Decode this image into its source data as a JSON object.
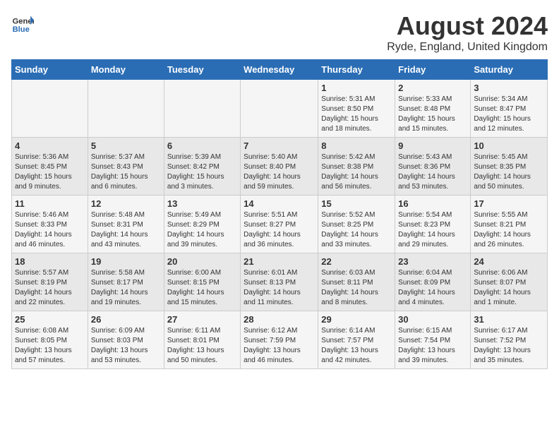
{
  "header": {
    "logo_line1": "General",
    "logo_line2": "Blue",
    "main_title": "August 2024",
    "subtitle": "Ryde, England, United Kingdom"
  },
  "days_of_week": [
    "Sunday",
    "Monday",
    "Tuesday",
    "Wednesday",
    "Thursday",
    "Friday",
    "Saturday"
  ],
  "weeks": [
    [
      {
        "num": "",
        "info": ""
      },
      {
        "num": "",
        "info": ""
      },
      {
        "num": "",
        "info": ""
      },
      {
        "num": "",
        "info": ""
      },
      {
        "num": "1",
        "info": "Sunrise: 5:31 AM\nSunset: 8:50 PM\nDaylight: 15 hours\nand 18 minutes."
      },
      {
        "num": "2",
        "info": "Sunrise: 5:33 AM\nSunset: 8:48 PM\nDaylight: 15 hours\nand 15 minutes."
      },
      {
        "num": "3",
        "info": "Sunrise: 5:34 AM\nSunset: 8:47 PM\nDaylight: 15 hours\nand 12 minutes."
      }
    ],
    [
      {
        "num": "4",
        "info": "Sunrise: 5:36 AM\nSunset: 8:45 PM\nDaylight: 15 hours\nand 9 minutes."
      },
      {
        "num": "5",
        "info": "Sunrise: 5:37 AM\nSunset: 8:43 PM\nDaylight: 15 hours\nand 6 minutes."
      },
      {
        "num": "6",
        "info": "Sunrise: 5:39 AM\nSunset: 8:42 PM\nDaylight: 15 hours\nand 3 minutes."
      },
      {
        "num": "7",
        "info": "Sunrise: 5:40 AM\nSunset: 8:40 PM\nDaylight: 14 hours\nand 59 minutes."
      },
      {
        "num": "8",
        "info": "Sunrise: 5:42 AM\nSunset: 8:38 PM\nDaylight: 14 hours\nand 56 minutes."
      },
      {
        "num": "9",
        "info": "Sunrise: 5:43 AM\nSunset: 8:36 PM\nDaylight: 14 hours\nand 53 minutes."
      },
      {
        "num": "10",
        "info": "Sunrise: 5:45 AM\nSunset: 8:35 PM\nDaylight: 14 hours\nand 50 minutes."
      }
    ],
    [
      {
        "num": "11",
        "info": "Sunrise: 5:46 AM\nSunset: 8:33 PM\nDaylight: 14 hours\nand 46 minutes."
      },
      {
        "num": "12",
        "info": "Sunrise: 5:48 AM\nSunset: 8:31 PM\nDaylight: 14 hours\nand 43 minutes."
      },
      {
        "num": "13",
        "info": "Sunrise: 5:49 AM\nSunset: 8:29 PM\nDaylight: 14 hours\nand 39 minutes."
      },
      {
        "num": "14",
        "info": "Sunrise: 5:51 AM\nSunset: 8:27 PM\nDaylight: 14 hours\nand 36 minutes."
      },
      {
        "num": "15",
        "info": "Sunrise: 5:52 AM\nSunset: 8:25 PM\nDaylight: 14 hours\nand 33 minutes."
      },
      {
        "num": "16",
        "info": "Sunrise: 5:54 AM\nSunset: 8:23 PM\nDaylight: 14 hours\nand 29 minutes."
      },
      {
        "num": "17",
        "info": "Sunrise: 5:55 AM\nSunset: 8:21 PM\nDaylight: 14 hours\nand 26 minutes."
      }
    ],
    [
      {
        "num": "18",
        "info": "Sunrise: 5:57 AM\nSunset: 8:19 PM\nDaylight: 14 hours\nand 22 minutes."
      },
      {
        "num": "19",
        "info": "Sunrise: 5:58 AM\nSunset: 8:17 PM\nDaylight: 14 hours\nand 19 minutes."
      },
      {
        "num": "20",
        "info": "Sunrise: 6:00 AM\nSunset: 8:15 PM\nDaylight: 14 hours\nand 15 minutes."
      },
      {
        "num": "21",
        "info": "Sunrise: 6:01 AM\nSunset: 8:13 PM\nDaylight: 14 hours\nand 11 minutes."
      },
      {
        "num": "22",
        "info": "Sunrise: 6:03 AM\nSunset: 8:11 PM\nDaylight: 14 hours\nand 8 minutes."
      },
      {
        "num": "23",
        "info": "Sunrise: 6:04 AM\nSunset: 8:09 PM\nDaylight: 14 hours\nand 4 minutes."
      },
      {
        "num": "24",
        "info": "Sunrise: 6:06 AM\nSunset: 8:07 PM\nDaylight: 14 hours\nand 1 minute."
      }
    ],
    [
      {
        "num": "25",
        "info": "Sunrise: 6:08 AM\nSunset: 8:05 PM\nDaylight: 13 hours\nand 57 minutes."
      },
      {
        "num": "26",
        "info": "Sunrise: 6:09 AM\nSunset: 8:03 PM\nDaylight: 13 hours\nand 53 minutes."
      },
      {
        "num": "27",
        "info": "Sunrise: 6:11 AM\nSunset: 8:01 PM\nDaylight: 13 hours\nand 50 minutes."
      },
      {
        "num": "28",
        "info": "Sunrise: 6:12 AM\nSunset: 7:59 PM\nDaylight: 13 hours\nand 46 minutes."
      },
      {
        "num": "29",
        "info": "Sunrise: 6:14 AM\nSunset: 7:57 PM\nDaylight: 13 hours\nand 42 minutes."
      },
      {
        "num": "30",
        "info": "Sunrise: 6:15 AM\nSunset: 7:54 PM\nDaylight: 13 hours\nand 39 minutes."
      },
      {
        "num": "31",
        "info": "Sunrise: 6:17 AM\nSunset: 7:52 PM\nDaylight: 13 hours\nand 35 minutes."
      }
    ]
  ]
}
